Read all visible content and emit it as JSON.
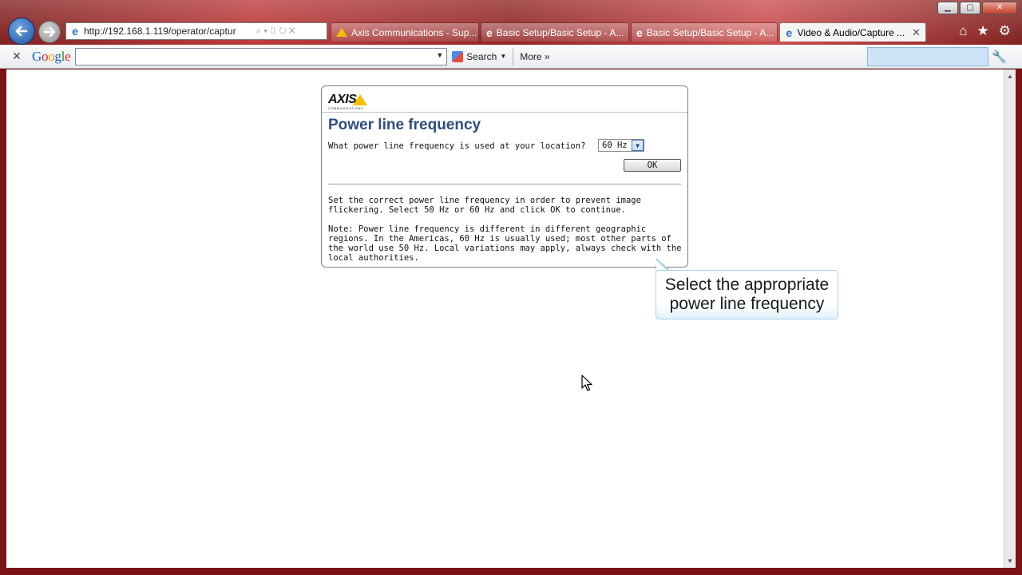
{
  "browser": {
    "address": "http://192.168.1.119/operator/captur",
    "tabs": [
      {
        "label": "Axis Communications - Sup...",
        "icon": "axis-favicon"
      },
      {
        "label": "Basic Setup/Basic Setup - A...",
        "icon": "ie-icon"
      },
      {
        "label": "Basic Setup/Basic Setup - A...",
        "icon": "ie-icon"
      },
      {
        "label": "Video & Audio/Capture ...",
        "icon": "ie-icon",
        "active": true
      }
    ],
    "tab_close": "✕",
    "win_buttons": {
      "minimize": "▁",
      "maximize": "▢",
      "close": "✕"
    }
  },
  "google_toolbar": {
    "close": "✕",
    "logo": {
      "G": "G",
      "o1": "o",
      "o2": "o",
      "g": "g",
      "l": "l",
      "e": "e"
    },
    "search_value": "",
    "search_label": "Search",
    "more_label": "More »"
  },
  "dialog": {
    "logo_text": "AXIS",
    "logo_sub": "COMMUNICATIONS",
    "title": "Power line frequency",
    "question": "What power line frequency is used at your location?",
    "frequency_selected": "60 Hz",
    "ok_label": "OK",
    "paragraph1": "Set the correct power line frequency in order to prevent image flickering. Select 50 Hz or 60 Hz and click OK to continue.",
    "paragraph2": "Note: Power line frequency is different in different geographic regions. In the Americas, 60 Hz is usually used; most other parts of the world use 50 Hz. Local variations may apply, always check with the local authorities."
  },
  "callout": {
    "line1": "Select the appropriate",
    "line2": "power line frequency"
  },
  "colors": {
    "title_blue": "#2f4d80",
    "callout_border": "#a9d0ee",
    "frame_red": "#7a1414"
  }
}
